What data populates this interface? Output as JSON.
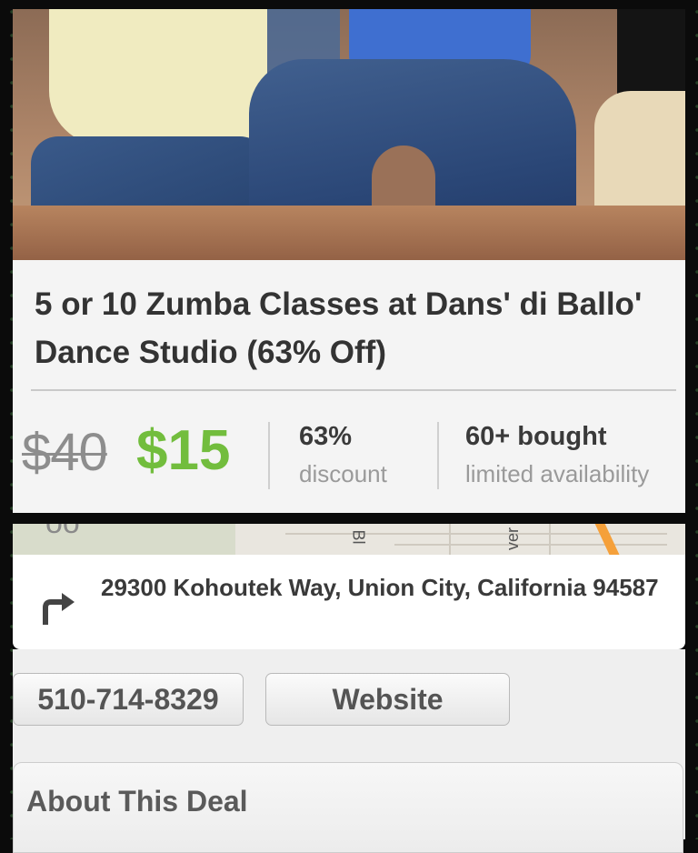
{
  "deal": {
    "title": "5 or 10 Zumba Classes at Dans' di Ballo' Dance Studio (63% Off)",
    "original_price": "$40",
    "price": "$15",
    "discount_value": "63%",
    "discount_label": "discount",
    "bought_value": "60+ bought",
    "bought_label": "limited availability",
    "colors": {
      "price_green": "#72bd3d",
      "text_dark": "#333333",
      "text_muted": "#9a9a9a"
    }
  },
  "map": {
    "label_left": "Bl",
    "label_right": "ver"
  },
  "address": {
    "icon": "turn-right-arrow-icon",
    "text": "29300 Kohoutek Way, Union City, California 94587"
  },
  "actions": {
    "phone_label": "510-714-8329",
    "website_label": "Website"
  },
  "about": {
    "title": "About This Deal"
  }
}
